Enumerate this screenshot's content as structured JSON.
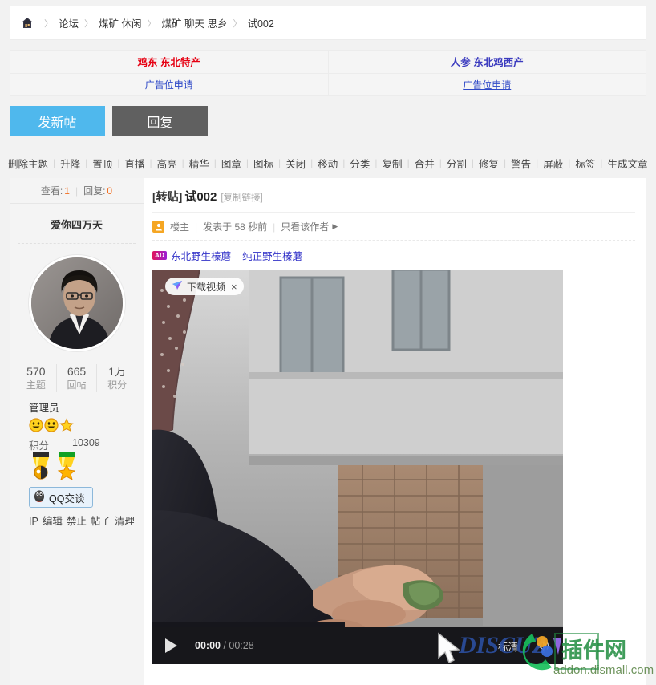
{
  "breadcrumb": {
    "home_icon": "home-icon",
    "items": [
      "论坛",
      "煤矿 休闲",
      "煤矿 聊天 思乡",
      "试002"
    ],
    "separator": "〉"
  },
  "ads": {
    "left": {
      "title": "鸡东 东北特产",
      "apply": "广告位申请",
      "color": "#e60012"
    },
    "right": {
      "title": "人参 东北鸡西产",
      "apply": "广告位申请",
      "color": "#3b3bbf"
    }
  },
  "buttons": {
    "new_post": "发新帖",
    "reply": "回复",
    "new_post_color": "#4fb8ed",
    "reply_color": "#606060"
  },
  "admin_toolbar": {
    "items": [
      "删除主题",
      "升降",
      "置顶",
      "直播",
      "高亮",
      "精华",
      "图章",
      "图标",
      "关闭",
      "移动",
      "分类",
      "复制",
      "合并",
      "分割",
      "修复",
      "警告",
      "屏蔽",
      "标签",
      "生成文章"
    ]
  },
  "sidebar": {
    "views_label": "查看:",
    "views_value": "1",
    "replies_label": "回复:",
    "replies_value": "0",
    "username": "爱你四万天",
    "counts": [
      {
        "value": "570",
        "label": "主题"
      },
      {
        "value": "665",
        "label": "回帖"
      },
      {
        "value": "1万",
        "label": "积分"
      }
    ],
    "role": "管理员",
    "points_label": "积分",
    "points_value": "10309",
    "qq_button": "QQ交谈",
    "ops": [
      "IP",
      "编辑",
      "禁止",
      "帖子",
      "清理"
    ],
    "accent": "#f26c1e"
  },
  "post": {
    "tag": "[转贴]",
    "title": "试002",
    "copy_link": "[复制链接]",
    "author_badge": "楼主",
    "posted_at": "发表于 58 秒前",
    "only_author": "只看该作者",
    "inline_ads": [
      "东北野生榛蘑",
      "纯正野生榛蘑"
    ],
    "ad_mark": "AD"
  },
  "video": {
    "download_label": "下载视频",
    "close_label": "×",
    "current_time": "00:00",
    "separator": "/",
    "duration": "00:28",
    "quality": "标清"
  },
  "watermark": {
    "brand": "DISCUZ",
    "suffix": "插件网",
    "domain": "addon.dismall.com"
  }
}
